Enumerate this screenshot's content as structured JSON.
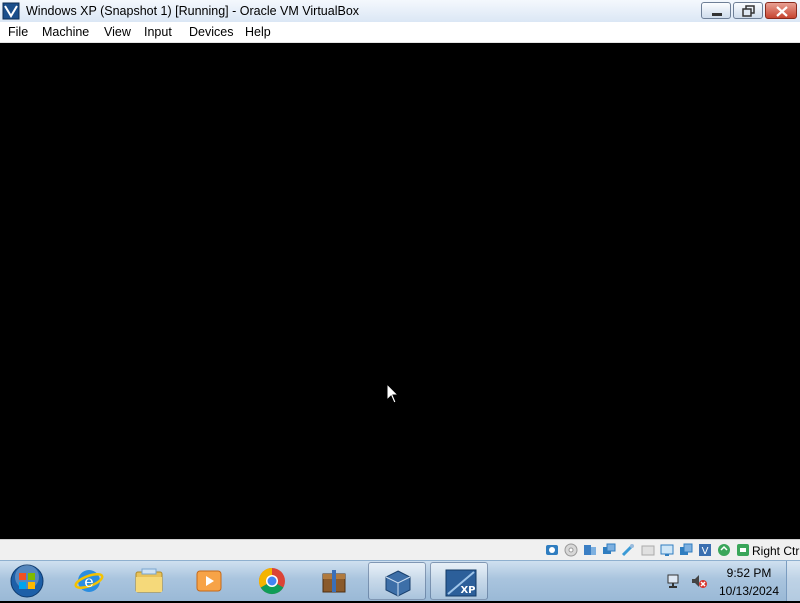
{
  "window": {
    "title": "Windows XP (Snapshot 1) [Running] - Oracle VM VirtualBox",
    "icon": "virtualbox-icon"
  },
  "menu": {
    "items": [
      "File",
      "Machine",
      "View",
      "Input",
      "Devices",
      "Help"
    ]
  },
  "statusbar": {
    "icons": [
      "hard-disk-icon",
      "optical-drive-icon",
      "audio-icon",
      "network-icon",
      "usb-icon",
      "shared-folders-icon",
      "display-icon",
      "video-capture-icon",
      "virtualization-icon",
      "mouse-integration-icon",
      "keyboard-capture-icon"
    ],
    "host_key": "Right Ctrl"
  },
  "taskbar": {
    "apps": [
      "internet-explorer-icon",
      "file-explorer-icon",
      "media-player-icon",
      "chrome-icon",
      "archive-icon",
      "virtualbox-icon",
      "windows-xp-vm-icon"
    ],
    "tray": {
      "icons": [
        "network-icon",
        "volume-muted-icon"
      ],
      "time": "9:52 PM",
      "date": "10/13/2024"
    }
  },
  "colors": {
    "vm_background": "#000000",
    "taskbar": "#a9c4de",
    "close_button": "#c74530"
  }
}
